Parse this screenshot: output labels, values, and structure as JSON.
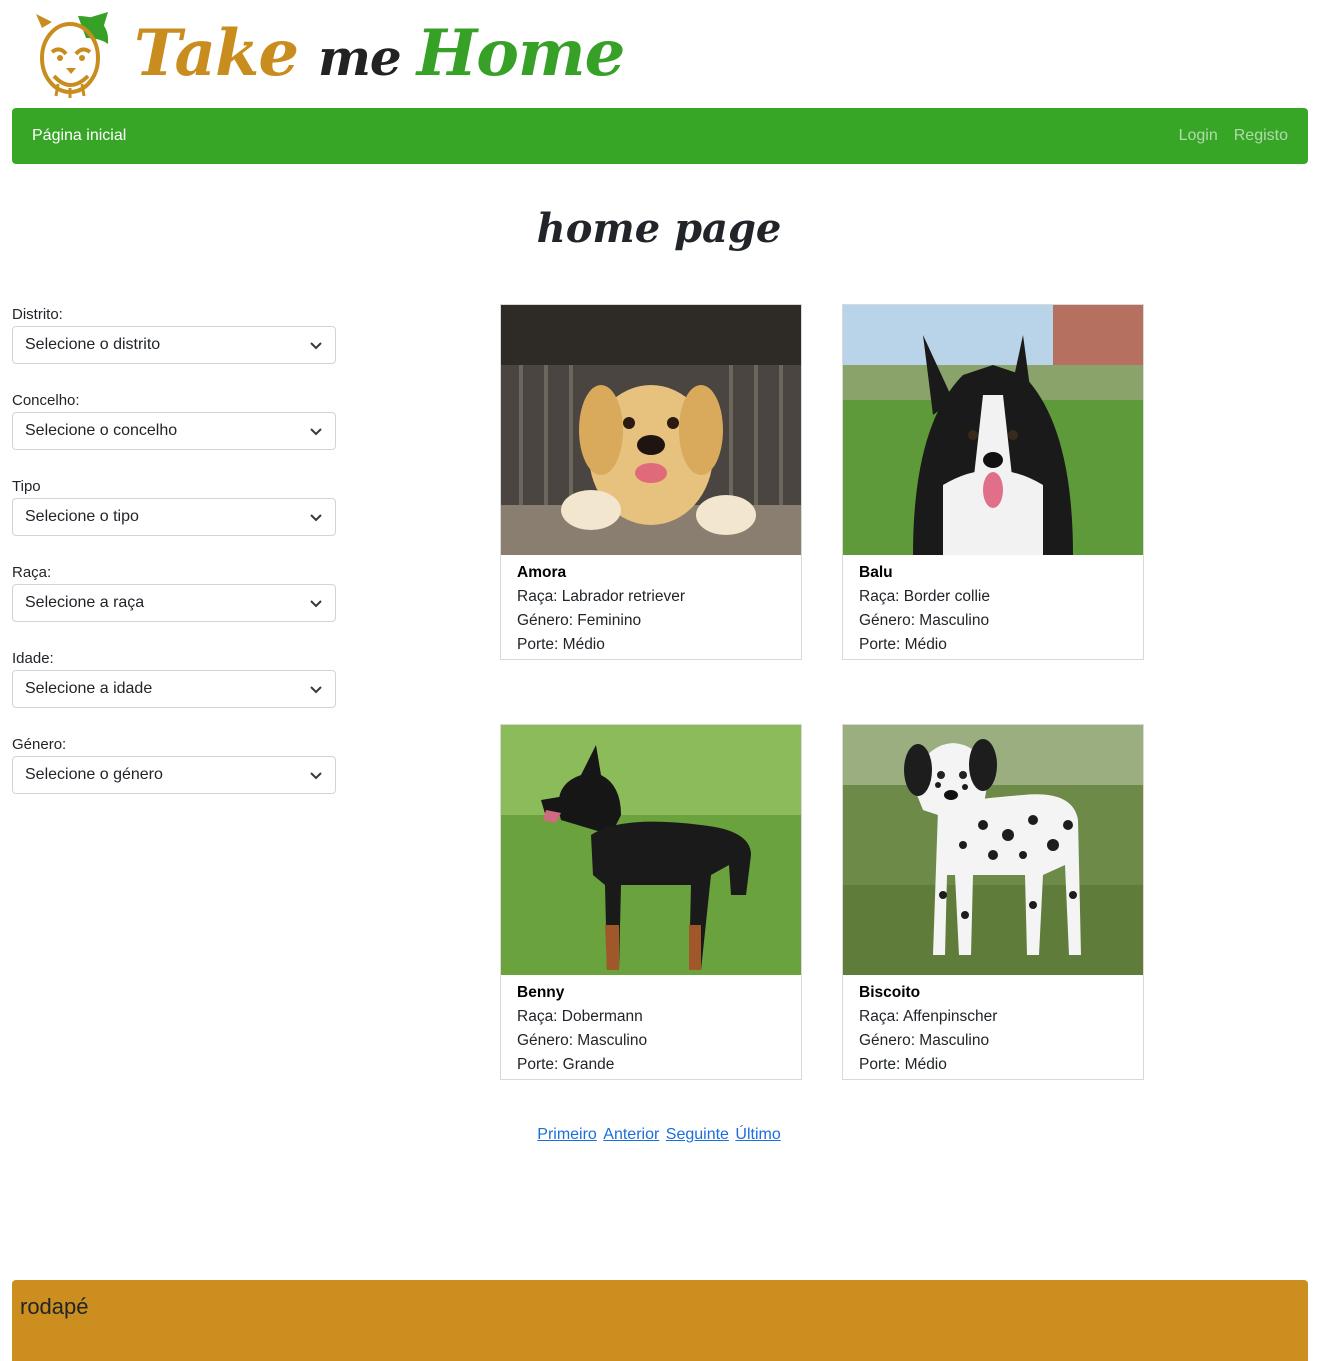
{
  "logo": {
    "word1": "Take",
    "word2": "me",
    "word3": "Home"
  },
  "nav": {
    "home": "Página inicial",
    "login": "Login",
    "register": "Registo"
  },
  "title": "home page",
  "filters": [
    {
      "label": "Distrito:",
      "value": "Selecione o distrito"
    },
    {
      "label": "Concelho:",
      "value": "Selecione o concelho"
    },
    {
      "label": "Tipo",
      "value": "Selecione o tipo"
    },
    {
      "label": "Raça:",
      "value": "Selecione a raça"
    },
    {
      "label": "Idade:",
      "value": "Selecione a idade"
    },
    {
      "label": "Género:",
      "value": "Selecione o género"
    }
  ],
  "animals": [
    {
      "name": "Amora",
      "breed": "Raça: Labrador retriever",
      "gender": "Género: Feminino",
      "size": "Porte: Médio",
      "photo_icon": "golden-dog-photo"
    },
    {
      "name": "Balu",
      "breed": "Raça: Border collie",
      "gender": "Género: Masculino",
      "size": "Porte: Médio",
      "photo_icon": "border-collie-photo"
    },
    {
      "name": "Benny",
      "breed": "Raça: Dobermann",
      "gender": "Género: Masculino",
      "size": "Porte: Grande",
      "photo_icon": "doberman-photo"
    },
    {
      "name": "Biscoito",
      "breed": "Raça: Affenpinscher",
      "gender": "Género: Masculino",
      "size": "Porte: Médio",
      "photo_icon": "dalmatian-photo"
    }
  ],
  "pagination": {
    "first": "Primeiro",
    "prev": "Anterior",
    "next": "Seguinte",
    "last": "Último"
  },
  "footer": "rodapé",
  "colors": {
    "green": "#37a627",
    "gold": "#cb8e1f",
    "link": "#1a6fdc"
  }
}
